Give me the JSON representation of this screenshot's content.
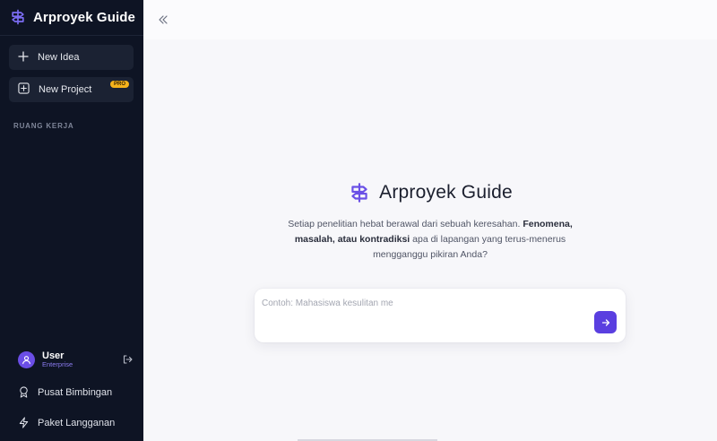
{
  "sidebar": {
    "brand_title": "Arproyek Guide",
    "brand_icon": "signpost-icon",
    "new_idea_label": "New Idea",
    "new_project_label": "New Project",
    "pro_badge": "PRO",
    "section_label": "RUANG KERJA",
    "user": {
      "name": "User",
      "plan": "Enterprise"
    },
    "menu": {
      "bimbingan_label": "Pusat Bimbingan",
      "paket_label": "Paket Langganan"
    }
  },
  "main": {
    "hero_title": "Arproyek Guide",
    "hero_desc": {
      "part1": "Setiap penelitian hebat berawal dari sebuah keresahan. ",
      "bold": "Fenomena, masalah, atau kontradiksi",
      "part2": " apa di lapangan yang terus-menerus mengganggu pikiran Anda?"
    },
    "input": {
      "placeholder": "Contoh: Mahasiswa kesulitan me",
      "value": ""
    }
  },
  "colors": {
    "sidebar_bg": "#0e1424",
    "accent": "#5a3fe0",
    "pro_badge": "#f5b21b"
  }
}
